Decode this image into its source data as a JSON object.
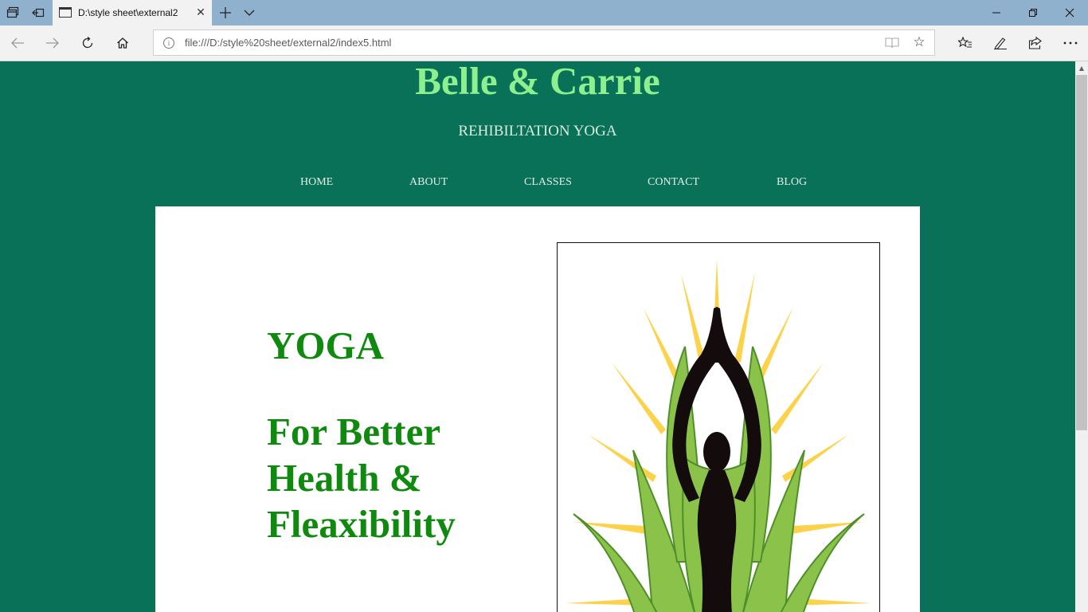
{
  "browser": {
    "tab": {
      "title": "D:\\style sheet\\external2"
    },
    "address": {
      "url": "file:///D:/style%20sheet/external2/index5.html"
    }
  },
  "page": {
    "title": "Belle & Carrie",
    "subtitle": "REHIBILTATION YOGA",
    "menu": [
      "HOME",
      "ABOUT",
      "CLASSES",
      "CONTACT",
      "BLOG"
    ],
    "heading_line1": "YOGA",
    "heading_line2": "For Better Health & Fleaxibility"
  },
  "colors": {
    "page_background": "#087157",
    "title": "#8cf08e",
    "heading": "#0f8a0f",
    "content_background": "#ffffff",
    "browser_frame": "#8fb1ce"
  },
  "icons": {
    "image_subject": "yoga-figure-icon"
  }
}
